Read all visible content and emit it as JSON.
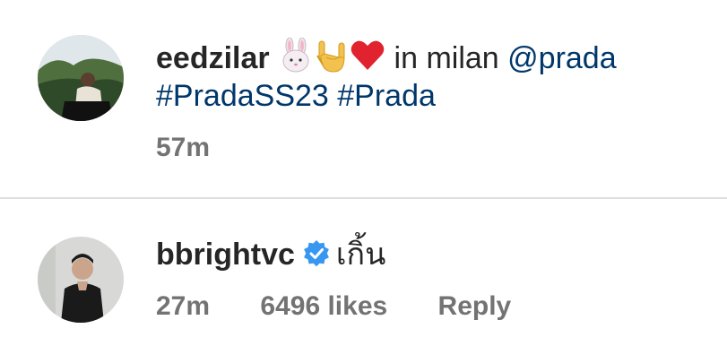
{
  "caption": {
    "username": "eedzilar",
    "emojis": [
      "rabbit-face-emoji",
      "love-you-gesture-emoji",
      "red-heart-emoji"
    ],
    "text": "in milan",
    "mention": "@prada",
    "hashtags": [
      "#PradaSS23",
      "#Prada"
    ],
    "time": "57m"
  },
  "reply": {
    "username": "bbrightvc",
    "verified": true,
    "text": "เกิ้น",
    "time": "27m",
    "likes": "6496 likes",
    "reply_label": "Reply"
  },
  "colors": {
    "link": "#00376b",
    "verified": "#3897f0",
    "meta": "#737373"
  }
}
